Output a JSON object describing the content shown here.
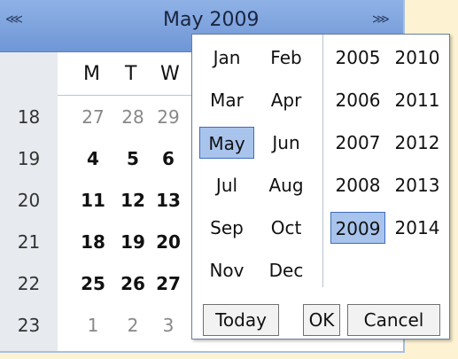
{
  "calendar": {
    "nav_prev": "⋘",
    "nav_next": "⋙",
    "title": "May 2009",
    "dow": [
      "M",
      "T",
      "W"
    ],
    "weeks": [
      {
        "num": "18",
        "days": [
          "27",
          "28",
          "29"
        ],
        "other": [
          true,
          true,
          true
        ]
      },
      {
        "num": "19",
        "days": [
          "4",
          "5",
          "6"
        ],
        "other": [
          false,
          false,
          false
        ]
      },
      {
        "num": "20",
        "days": [
          "11",
          "12",
          "13"
        ],
        "other": [
          false,
          false,
          false
        ]
      },
      {
        "num": "21",
        "days": [
          "18",
          "19",
          "20"
        ],
        "other": [
          false,
          false,
          false
        ]
      },
      {
        "num": "22",
        "days": [
          "25",
          "26",
          "27"
        ],
        "other": [
          false,
          false,
          false
        ]
      },
      {
        "num": "23",
        "days": [
          "1",
          "2",
          "3"
        ],
        "other": [
          true,
          true,
          true
        ]
      }
    ]
  },
  "picker": {
    "months": [
      "Jan",
      "Feb",
      "Mar",
      "Apr",
      "May",
      "Jun",
      "Jul",
      "Aug",
      "Sep",
      "Oct",
      "Nov",
      "Dec"
    ],
    "selected_month": "May",
    "years": [
      "2005",
      "2010",
      "2006",
      "2011",
      "2007",
      "2012",
      "2008",
      "2013",
      "2009",
      "2014"
    ],
    "selected_year": "2009",
    "today_label": "Today",
    "ok_label": "OK",
    "cancel_label": "Cancel"
  },
  "colors": {
    "header": "#7aa0dc",
    "selected": "#a9c4ec",
    "background": "#fdf3d2"
  }
}
